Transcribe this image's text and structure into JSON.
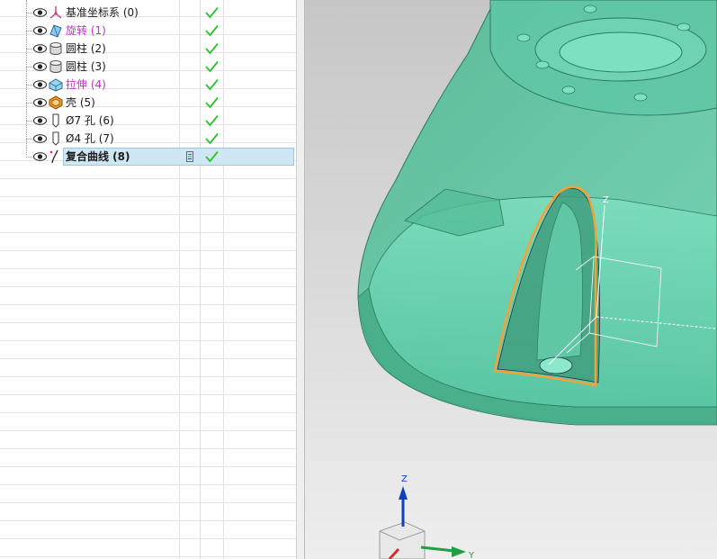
{
  "part_navigator": {
    "features": [
      {
        "label": "基准坐标系 (0)",
        "icon": "datum-csys-icon",
        "color": "#1a1a1a",
        "checked": true
      },
      {
        "label": "旋转 (1)",
        "icon": "revolve-icon",
        "color": "#c033c6",
        "checked": true
      },
      {
        "label": "圆柱 (2)",
        "icon": "cylinder-icon",
        "color": "#1a1a1a",
        "checked": true
      },
      {
        "label": "圆柱 (3)",
        "icon": "cylinder-icon",
        "color": "#1a1a1a",
        "checked": true
      },
      {
        "label": "拉伸 (4)",
        "icon": "extrude-icon",
        "color": "#c033c6",
        "checked": true
      },
      {
        "label": "壳 (5)",
        "icon": "shell-icon",
        "color": "#1a1a1a",
        "checked": true
      },
      {
        "label": "Ø7 孔 (6)",
        "icon": "hole-icon",
        "color": "#1a1a1a",
        "checked": true
      },
      {
        "label": "Ø4 孔 (7)",
        "icon": "hole-icon",
        "color": "#1a1a1a",
        "checked": true
      },
      {
        "label": "复合曲线 (8)",
        "icon": "composite-curve-icon",
        "color": "#1a1a1a",
        "checked": true,
        "selected": true
      }
    ]
  },
  "viewport": {
    "model_color": "#5fc7a6",
    "curve_color": "#f5a13a",
    "triad": {
      "z_label": "Z",
      "y_label": "Y"
    },
    "csys_z_label": "Z"
  },
  "colors": {
    "check": "#2fbf2f",
    "selection": "#cfe7f3"
  }
}
